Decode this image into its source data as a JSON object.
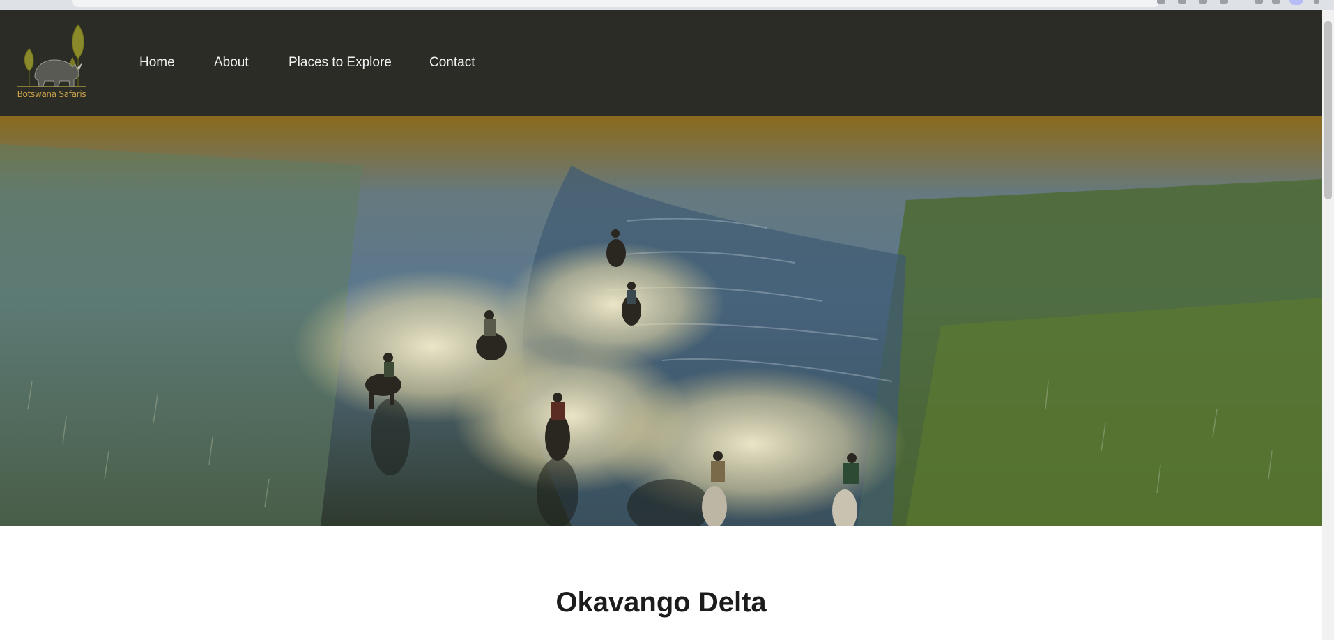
{
  "site": {
    "logo_text": "Botswana Safaris",
    "logo_icon": "rhino-with-trees-logo"
  },
  "nav": {
    "items": [
      {
        "label": "Home"
      },
      {
        "label": "About"
      },
      {
        "label": "Places to Explore"
      },
      {
        "label": "Contact"
      }
    ]
  },
  "hero": {
    "image_subject": "riders-on-horseback-crossing-delta-water"
  },
  "main": {
    "title": "Okavango Delta"
  },
  "colors": {
    "navbar_bg": "#2c2c27",
    "nav_text": "#f2f2f2",
    "logo_gold": "#c9a24a",
    "title_text": "#1c1c1c"
  }
}
